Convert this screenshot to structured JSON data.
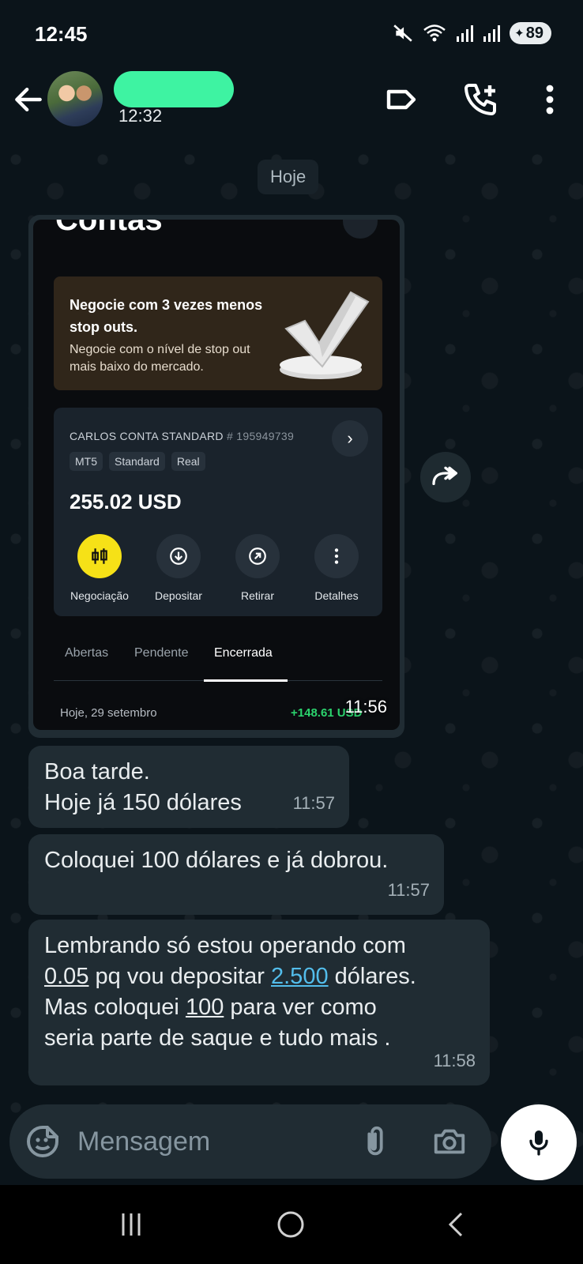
{
  "status_bar": {
    "time": "12:45",
    "battery": "89"
  },
  "header": {
    "last_seen": "12:32"
  },
  "date_chip": "Hoje",
  "image_message": {
    "time": "11:56",
    "screenshot": {
      "title": "Contas",
      "promo_title": "Negocie com 3 vezes menos stop outs.",
      "promo_sub": "Negocie com o nível de stop out mais baixo do mercado.",
      "account_name": "CARLOS CONTA STANDARD",
      "account_number": "# 195949739",
      "tags": [
        "MT5",
        "Standard",
        "Real"
      ],
      "balance": "255.02 USD",
      "actions": [
        "Negociação",
        "Depositar",
        "Retirar",
        "Detalhes"
      ],
      "tabs": [
        "Abertas",
        "Pendente",
        "Encerrada"
      ],
      "history_date": "Hoje, 29 setembro",
      "history_amount": "+148.61 USD"
    }
  },
  "messages": [
    {
      "lines": [
        "Boa tarde.",
        "Hoje já 150 dólares"
      ],
      "time": "11:57"
    },
    {
      "lines": [
        "Coloquei 100 dólares e já dobrou."
      ],
      "time": "11:57"
    },
    {
      "line1": "Lembrando só estou operando com",
      "l2_a": "0.05",
      "l2_b": " pq vou depositar ",
      "l2_c": "2.500",
      "l2_d": " dólares.",
      "l3_a": "Mas coloquei ",
      "l3_b": "100",
      "l3_c": " para ver como",
      "line4": "seria parte de saque e tudo mais .",
      "time": "11:58"
    }
  ],
  "composer": {
    "placeholder": "Mensagem"
  }
}
